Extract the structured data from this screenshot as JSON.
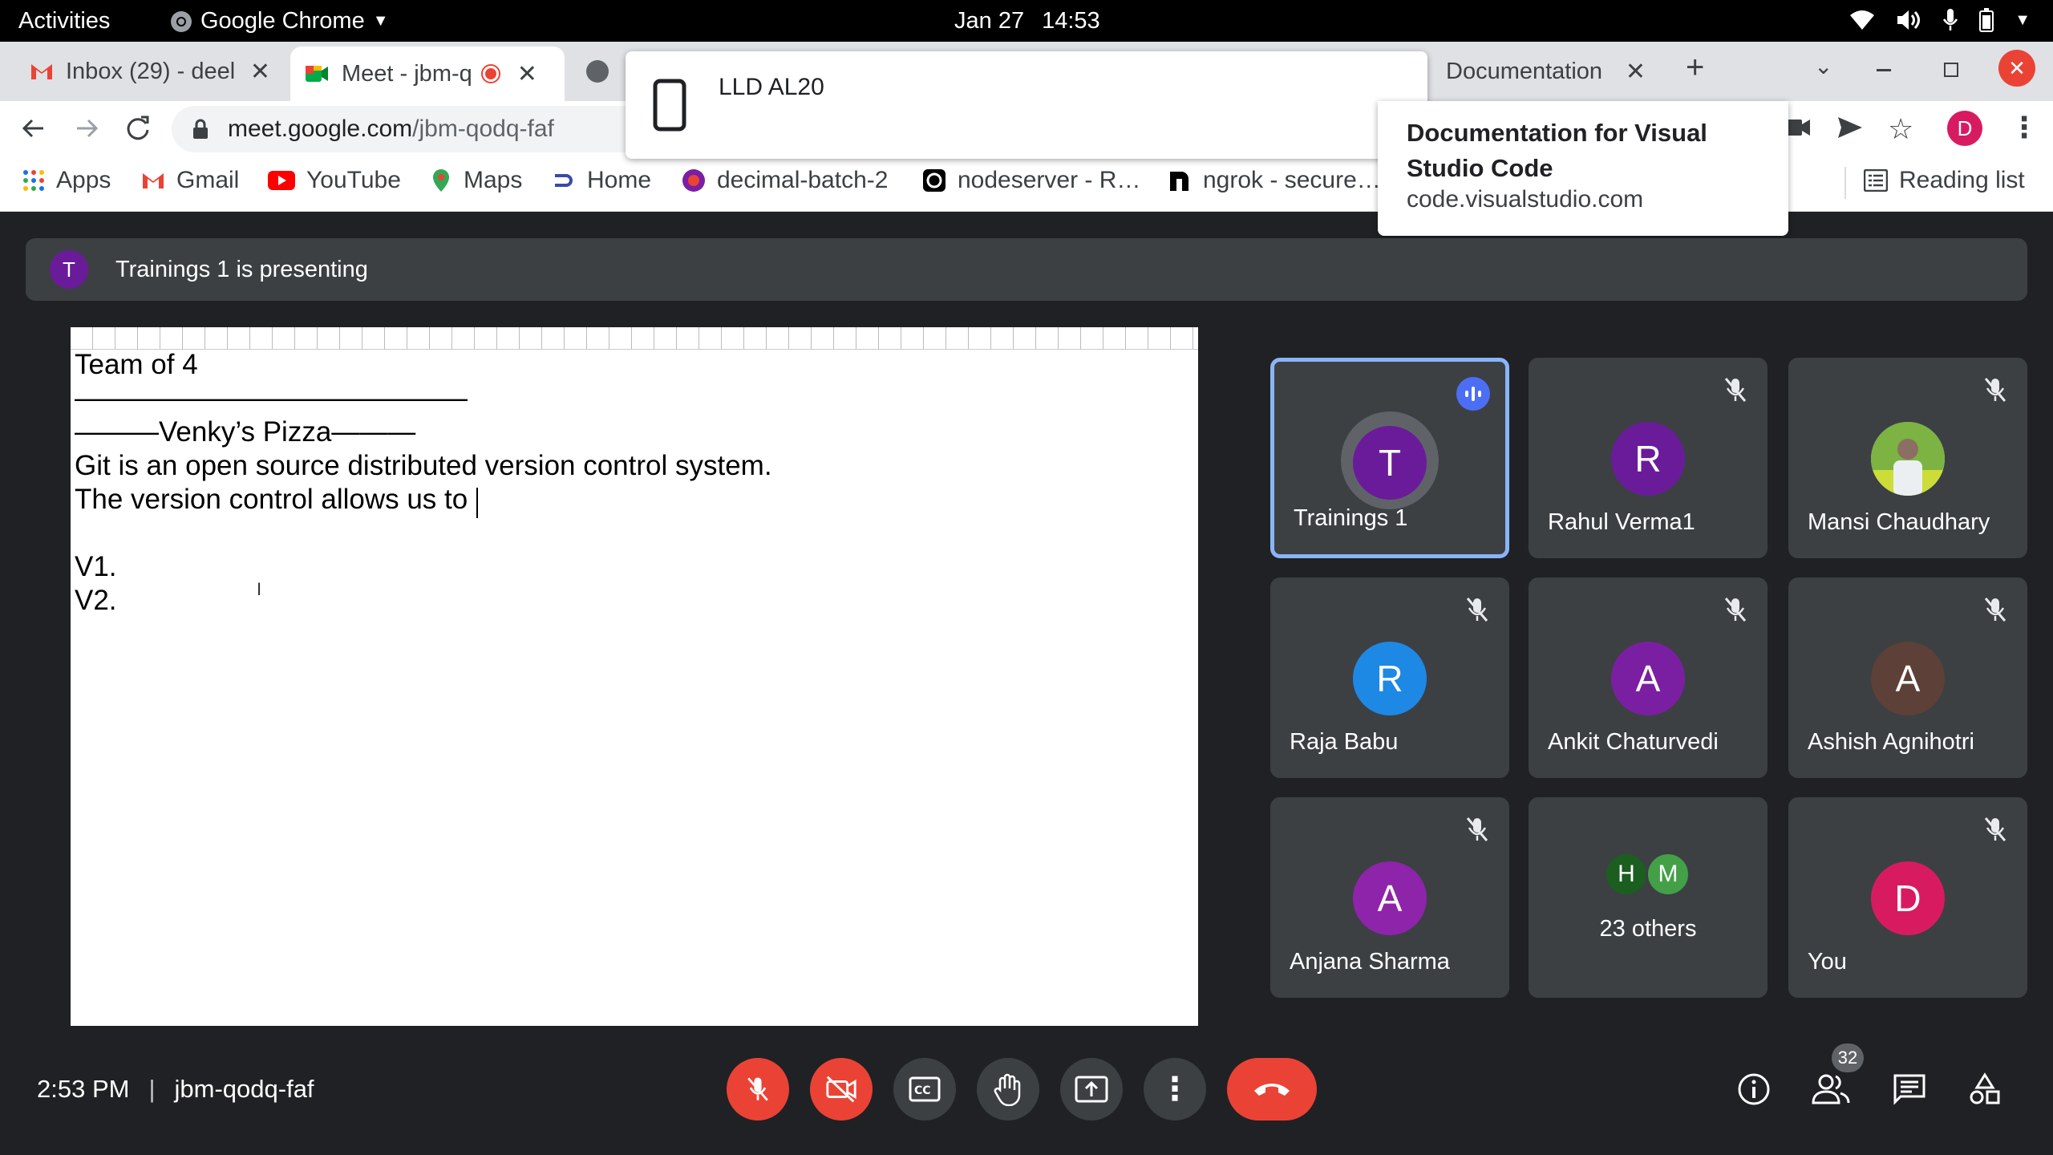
{
  "os": {
    "activities": "Activities",
    "app_name": "Google Chrome",
    "date": "Jan 27",
    "time": "14:53"
  },
  "tabs": [
    {
      "title": "Inbox (29) - deel"
    },
    {
      "title": "Meet - jbm-q"
    },
    {
      "title": "Documentation"
    }
  ],
  "address": {
    "host": "meet.google.com",
    "path": "/jbm-qodq-faf"
  },
  "profile_initial": "D",
  "bookmarks": {
    "apps": "Apps",
    "gmail": "Gmail",
    "youtube": "YouTube",
    "maps": "Maps",
    "home": "Home",
    "decimal": "decimal-batch-2",
    "nodeserver": "nodeserver - R…",
    "ngrok": "ngrok - secure…",
    "reading_list": "Reading list"
  },
  "cast_popup": {
    "device": "LLD AL20"
  },
  "tab_tooltip": {
    "title": "Documentation for Visual Studio Code",
    "url": "code.visualstudio.com"
  },
  "meet": {
    "presenter_initial": "T",
    "presenting_text": "Trainings 1 is presenting",
    "doc_lines": [
      "Team of 4",
      "——————————————",
      "———Venky’s Pizza———",
      "Git is an open source distributed version control system.",
      "The version control allows us to ",
      "",
      "V1.",
      "V2."
    ],
    "participants": [
      {
        "initial": "T",
        "name": "Trainings 1",
        "color": "#6a1b9a"
      },
      {
        "initial": "R",
        "name": "Rahul Verma1",
        "color": "#6a1b9a"
      },
      {
        "initial": "",
        "name": "Mansi Chaudhary",
        "color": "#9e9e9e"
      },
      {
        "initial": "R",
        "name": "Raja Babu",
        "color": "#1e88e5"
      },
      {
        "initial": "A",
        "name": "Ankit Chaturvedi",
        "color": "#7b1fa2"
      },
      {
        "initial": "A",
        "name": "Ashish Agnihotri",
        "color": "#5d4037"
      },
      {
        "initial": "A",
        "name": "Anjana Sharma",
        "color": "#8e24aa"
      },
      {
        "initial": "D",
        "name": "You",
        "color": "#d81b60"
      }
    ],
    "others": {
      "initials": [
        "H",
        "M"
      ],
      "colors": [
        "#1b5e20",
        "#43a047"
      ],
      "label": "23 others"
    },
    "time": "2:53 PM",
    "separator": "|",
    "meeting_code": "jbm-qodq-faf",
    "people_count": "32"
  }
}
